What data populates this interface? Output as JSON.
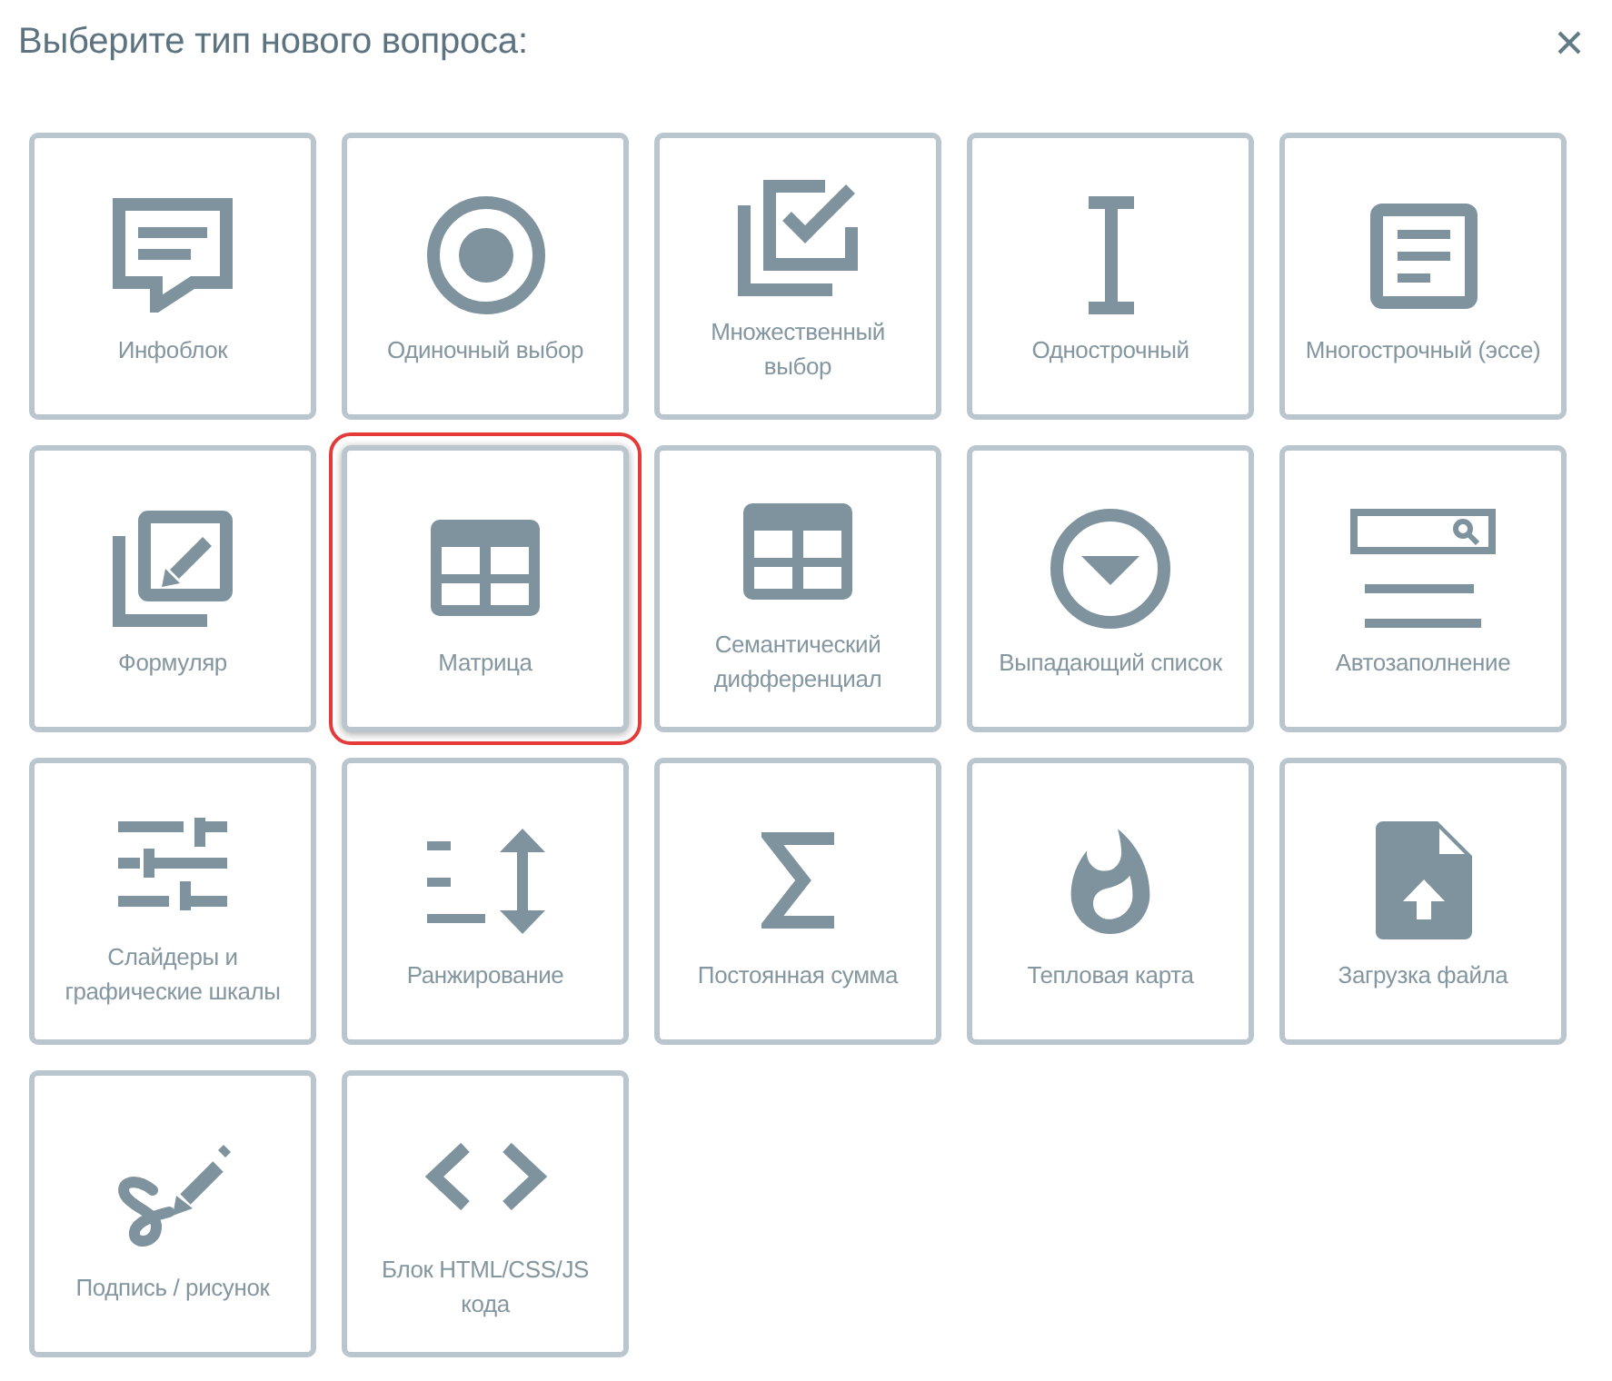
{
  "dialog": {
    "title": "Выберите тип нового вопроса:"
  },
  "question_types": [
    {
      "kind": "infoblock",
      "label": "Инфоблок",
      "selected": false
    },
    {
      "kind": "single_choice",
      "label": "Одиночный выбор",
      "selected": false
    },
    {
      "kind": "multiple_choice",
      "label": "Множественный\nвыбор",
      "selected": false
    },
    {
      "kind": "single_line",
      "label": "Однострочный",
      "selected": false
    },
    {
      "kind": "multi_line",
      "label": "Многострочный (эссе)",
      "selected": false
    },
    {
      "kind": "form",
      "label": "Формуляр",
      "selected": false
    },
    {
      "kind": "matrix",
      "label": "Матрица",
      "selected": true
    },
    {
      "kind": "semantic_differential",
      "label": "Семантический\nдифференциал",
      "selected": false
    },
    {
      "kind": "dropdown",
      "label": "Выпадающий список",
      "selected": false
    },
    {
      "kind": "autocomplete",
      "label": "Автозаполнение",
      "selected": false
    },
    {
      "kind": "sliders",
      "label": "Слайдеры и\nграфические шкалы",
      "selected": false
    },
    {
      "kind": "ranking",
      "label": "Ранжирование",
      "selected": false
    },
    {
      "kind": "constant_sum",
      "label": "Постоянная сумма",
      "selected": false
    },
    {
      "kind": "heat_map",
      "label": "Тепловая карта",
      "selected": false
    },
    {
      "kind": "file_upload",
      "label": "Загрузка файла",
      "selected": false
    },
    {
      "kind": "signature",
      "label": "Подпись / рисунок",
      "selected": false
    },
    {
      "kind": "code",
      "label": "Блок HTML/CSS/JS\nкода",
      "selected": false
    }
  ]
}
